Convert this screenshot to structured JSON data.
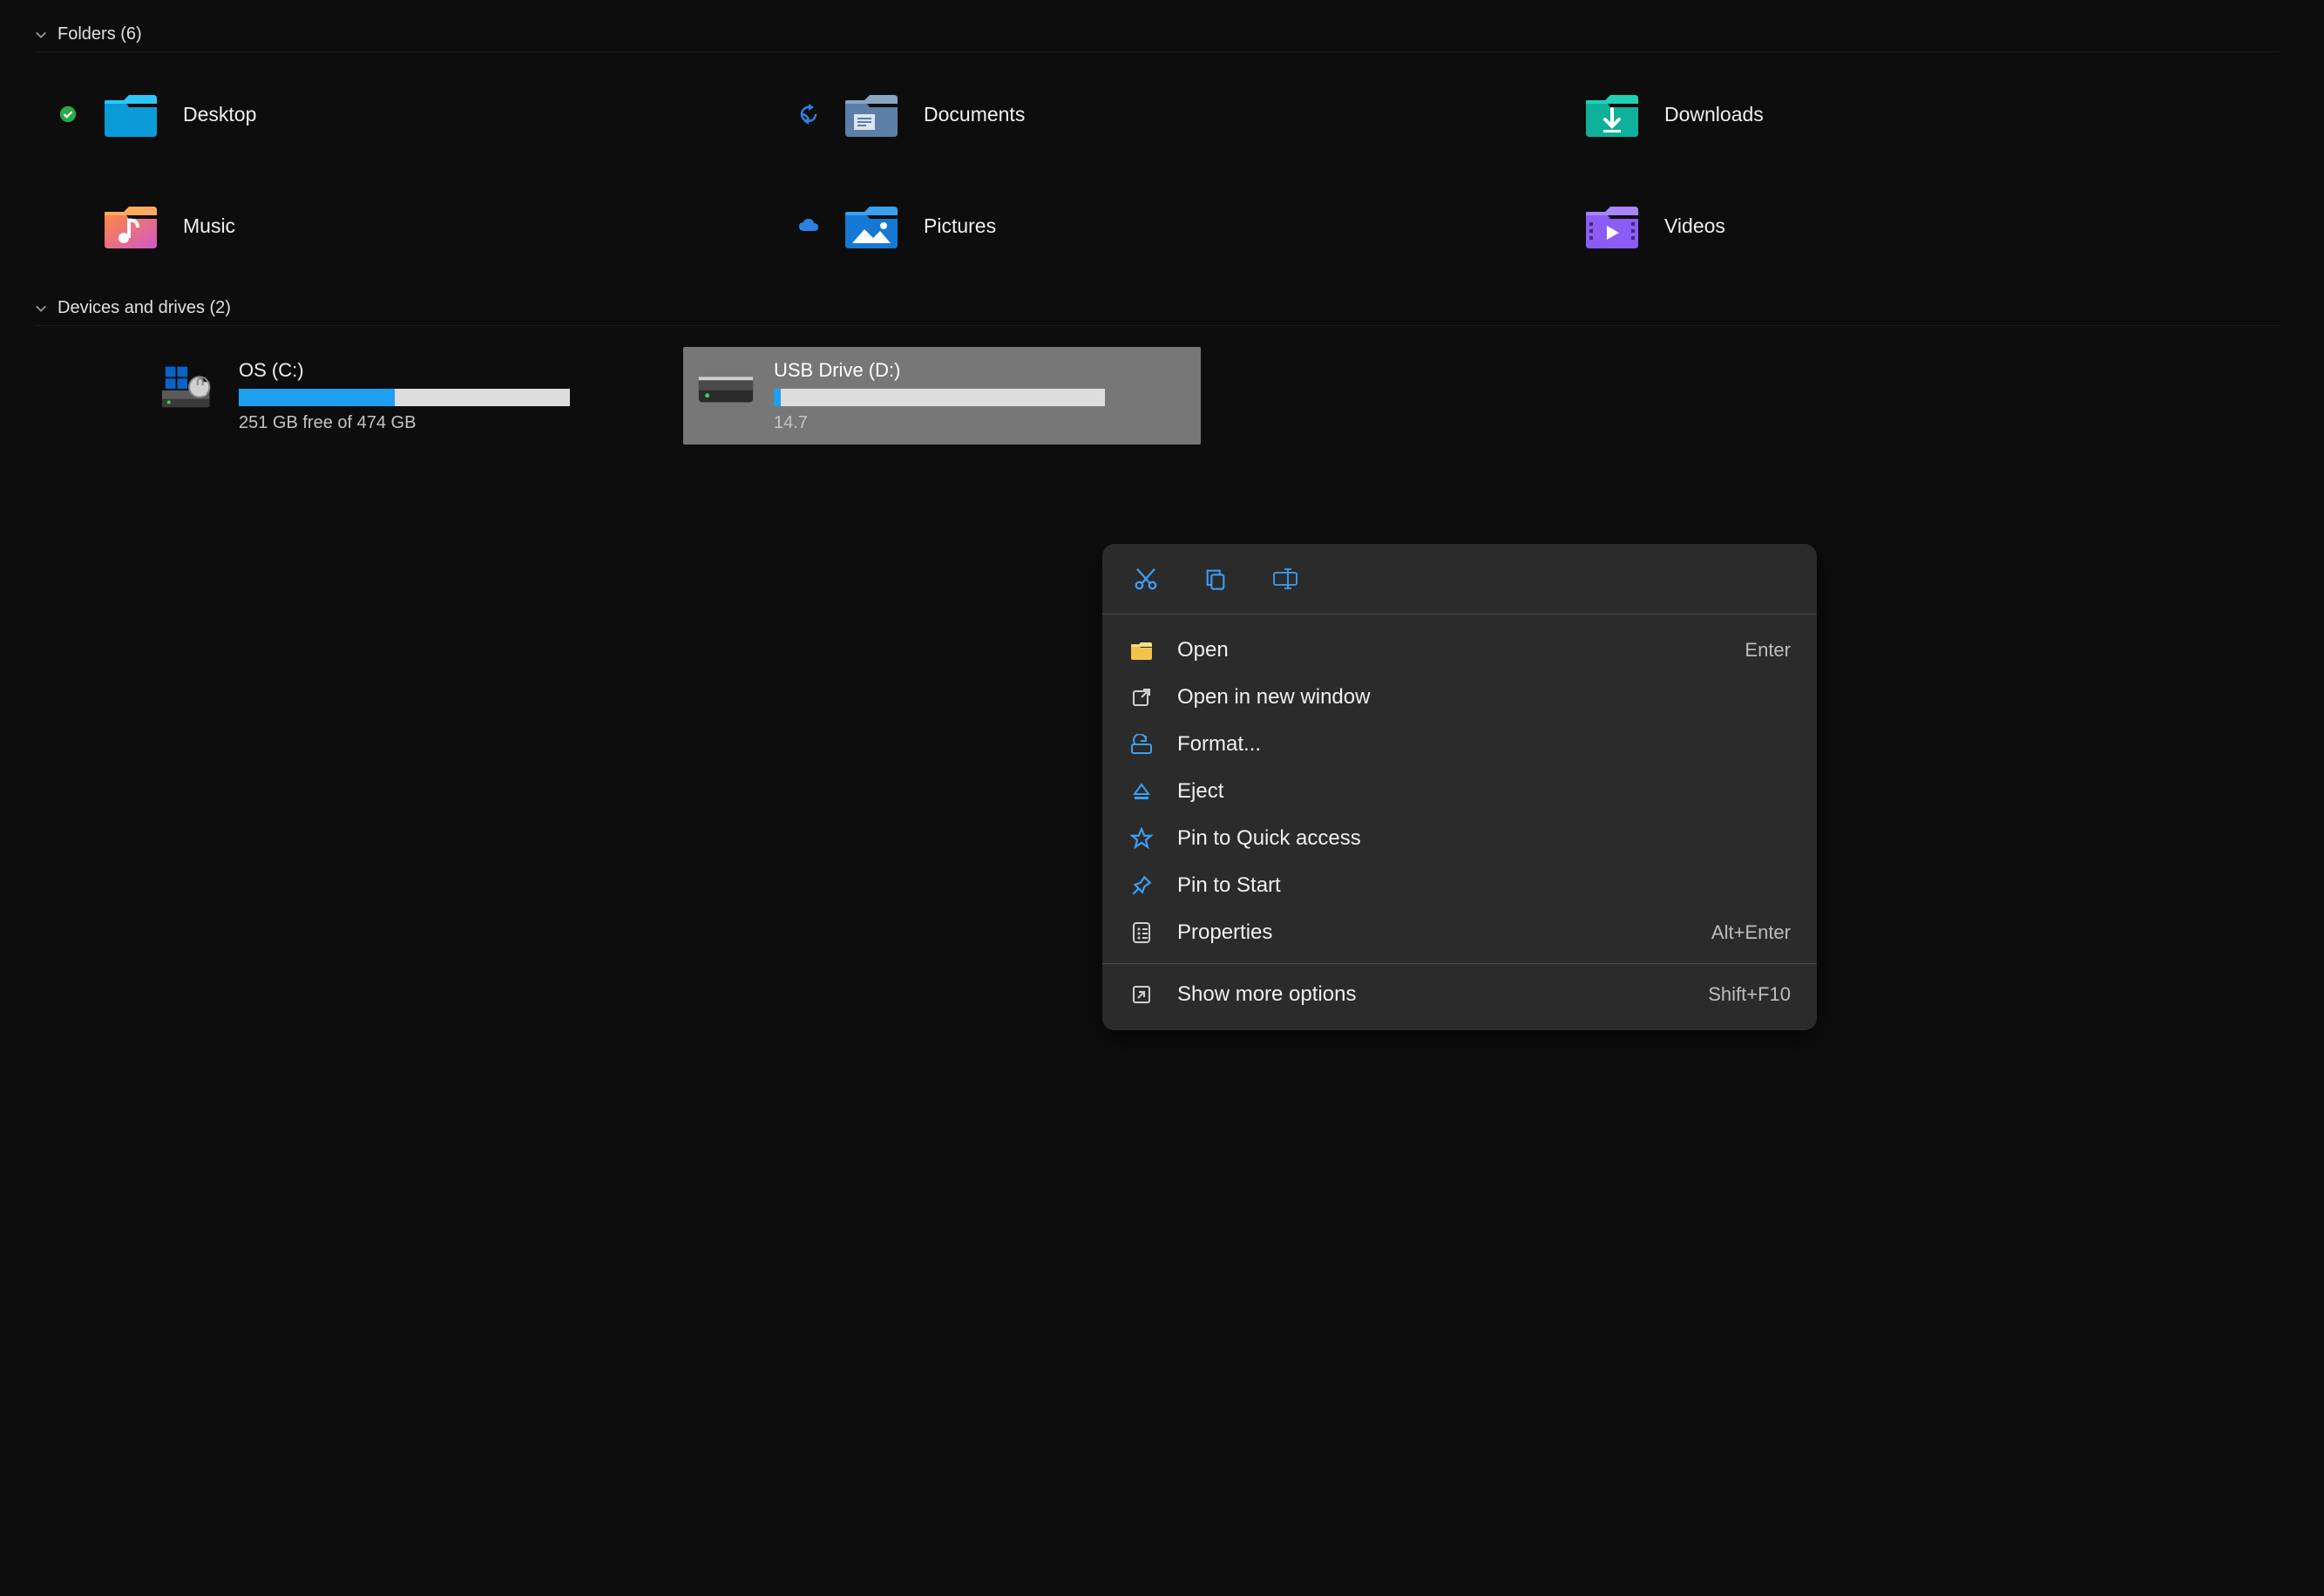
{
  "groups": {
    "folders": {
      "title": "Folders (6)"
    },
    "drives": {
      "title": "Devices and drives (2)"
    }
  },
  "folders": [
    {
      "label": "Desktop",
      "status": "synced"
    },
    {
      "label": "Documents",
      "status": "refresh"
    },
    {
      "label": "Downloads",
      "status": ""
    },
    {
      "label": "Music",
      "status": ""
    },
    {
      "label": "Pictures",
      "status": "cloud"
    },
    {
      "label": "Videos",
      "status": ""
    }
  ],
  "drives": [
    {
      "title": "OS (C:)",
      "subtitle": "251 GB free of 474 GB",
      "used_pct": 47,
      "selected": false
    },
    {
      "title": "USB Drive (D:)",
      "subtitle": "14.7",
      "used_pct": 2,
      "selected": true
    }
  ],
  "context_menu": {
    "items": [
      {
        "label": "Open",
        "hint": "Enter"
      },
      {
        "label": "Open in new window",
        "hint": ""
      },
      {
        "label": "Format...",
        "hint": ""
      },
      {
        "label": "Eject",
        "hint": ""
      },
      {
        "label": "Pin to Quick access",
        "hint": ""
      },
      {
        "label": "Pin to Start",
        "hint": ""
      },
      {
        "label": "Properties",
        "hint": "Alt+Enter"
      },
      {
        "label": "Show more options",
        "hint": "Shift+F10"
      }
    ]
  }
}
